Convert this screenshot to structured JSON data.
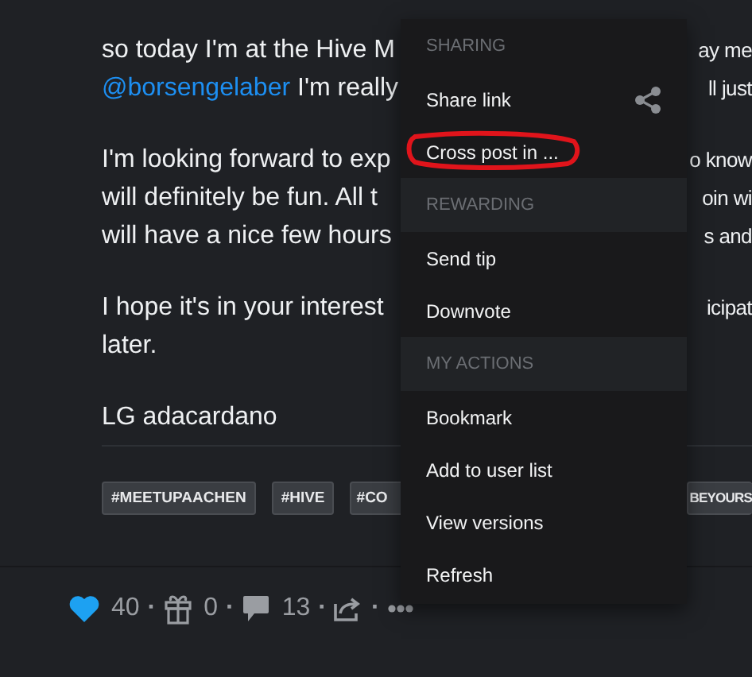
{
  "article": {
    "paragraphs": [
      {
        "lines": [
          {
            "left": [
              {
                "kind": "text",
                "text": "so today I'm at the Hive M"
              }
            ],
            "right": "ay me"
          },
          {
            "left": [
              {
                "kind": "link",
                "text": "@borsengelaber"
              },
              {
                "kind": "text",
                "text": " I'm really"
              }
            ],
            "right": "ll just"
          }
        ]
      },
      {
        "lines": [
          {
            "left": [
              {
                "kind": "text",
                "text": "I'm looking forward to exp"
              }
            ],
            "right": "o know"
          },
          {
            "left": [
              {
                "kind": "text",
                "text": "will definitely be fun. All t"
              }
            ],
            "right": "oin wi"
          },
          {
            "left": [
              {
                "kind": "text",
                "text": "will have a nice few hours"
              }
            ],
            "right": "s and"
          }
        ]
      },
      {
        "lines": [
          {
            "left": [
              {
                "kind": "text",
                "text": "I hope it's in your interest"
              }
            ],
            "right": "icipat"
          },
          {
            "left": [
              {
                "kind": "text",
                "text": "later."
              }
            ]
          }
        ]
      },
      {
        "lines": [
          {
            "left": [
              {
                "kind": "text",
                "text": "LG adacardano"
              }
            ]
          }
        ]
      }
    ]
  },
  "tags": {
    "left": [
      "#MEETUPAACHEN",
      "#HIVE",
      "#CO"
    ],
    "right": "BEYOURS"
  },
  "footer": [
    {
      "kind": "heart",
      "text": "40"
    },
    {
      "kind": "separator",
      "text": "·"
    },
    {
      "kind": "gift",
      "text": "0"
    },
    {
      "kind": "separator",
      "text": "·"
    },
    {
      "kind": "comment",
      "text": "13"
    },
    {
      "kind": "separator",
      "text": "·"
    },
    {
      "kind": "reblog"
    },
    {
      "kind": "separator",
      "text": "·"
    },
    {
      "kind": "more"
    }
  ],
  "menu": {
    "sections": [
      {
        "header": "SHARING",
        "items": [
          {
            "label": "Share link",
            "kind": "with-icon",
            "circled": false
          },
          {
            "label": "Cross post in ...",
            "kind": "plain",
            "circled": true
          }
        ]
      },
      {
        "header": "REWARDING",
        "items": [
          {
            "label": "Send tip",
            "kind": "plain",
            "circled": false
          },
          {
            "label": "Downvote",
            "kind": "plain",
            "circled": false
          }
        ]
      },
      {
        "header": "MY ACTIONS",
        "items": [
          {
            "label": "Bookmark",
            "kind": "plain",
            "circled": false
          },
          {
            "label": "Add to user list",
            "kind": "plain",
            "circled": false
          },
          {
            "label": "View versions",
            "kind": "plain",
            "circled": false
          },
          {
            "label": "Refresh",
            "kind": "plain",
            "circled": false
          }
        ]
      }
    ]
  }
}
